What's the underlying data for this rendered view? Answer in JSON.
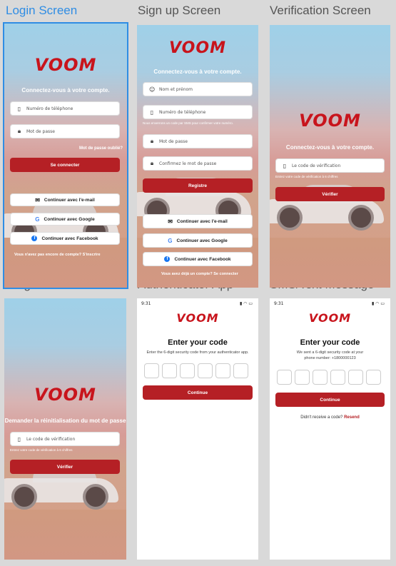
{
  "labels": {
    "login": "Login Screen",
    "signup": "Sign up Screen",
    "verification": "Verification Screen",
    "forgot": "Forgot Password -...",
    "authenticator": "Authenticator App",
    "sms": "SMS/Text Message"
  },
  "brand": "VOOM",
  "login": {
    "tagline": "Connectez-vous à votre compte.",
    "phone_placeholder": "Numéro de téléphone",
    "password_placeholder": "Mot de passe",
    "forgot_link": "Mot de passe oublié?",
    "signin_button": "Se connecter",
    "email_button": "Continuer avec l'e-mail",
    "google_button": "Continuer avec Google",
    "facebook_button": "Continuer avec Facebook",
    "signup_prompt": "Vous n'avez pas encore de compte? S'inscrire"
  },
  "signup": {
    "tagline": "Connectez-vous à votre compte.",
    "name_placeholder": "Nom et prénom",
    "phone_placeholder": "Numéro de téléphone",
    "sms_note": "Nous enverrons un code par SMS pour confirmer votre numéro.",
    "password_placeholder": "Mot de passe",
    "confirm_placeholder": "Confirmez le mot de passe",
    "register_button": "Registre",
    "email_button": "Continuer avec l'e-mail",
    "google_button": "Continuer avec Google",
    "facebook_button": "Continuer avec Facebook",
    "login_prompt": "Vous avez déjà un compte? Se connecter"
  },
  "verification": {
    "tagline": "Connectez-vous à votre compte.",
    "code_placeholder": "Le code de vérification",
    "code_note": "Entrez votre code de vérification à 6 chiffres",
    "verify_button": "Vérifier"
  },
  "forgot": {
    "tagline": "Demander la réinitialisation du mot de passe",
    "code_placeholder": "Le code de vérification",
    "code_note": "Entrez votre code de vérification à 6 chiffres",
    "verify_button": "Vérifier"
  },
  "authenticator": {
    "time": "9:31",
    "title": "Enter your code",
    "desc": "Enter the 6-digit security code from your authenticator app.",
    "continue_button": "Continue"
  },
  "sms": {
    "time": "9:31",
    "title": "Enter your code",
    "desc": "We sent a 6-digit security code at your phone number: +1800000123",
    "continue_button": "Continue",
    "resend_prompt": "Didn't receive a code?",
    "resend_link": "Resend"
  },
  "colors": {
    "accent": "#b52025",
    "selection": "#2f8de4"
  }
}
